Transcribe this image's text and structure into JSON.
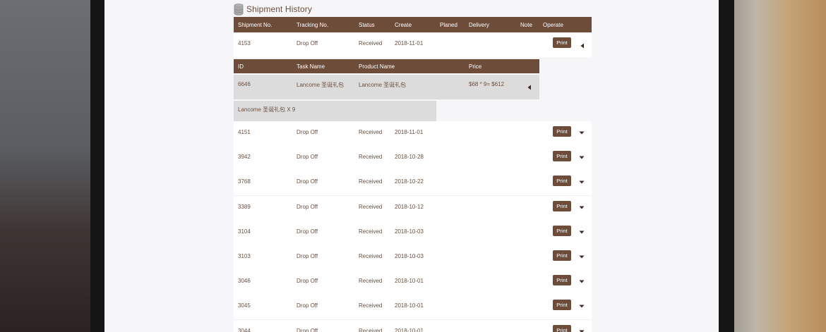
{
  "page_title": "Shipment History",
  "columns": [
    "Shipment No.",
    "Tracking No.",
    "Status",
    "Create",
    "Planed",
    "Delivery",
    "Note",
    "Operate"
  ],
  "expanded_shipment": {
    "no": "4153",
    "tracking": "Drop Off",
    "status": "Received",
    "create": "2018-11-01",
    "print_label": "Print",
    "detail_columns": [
      "ID",
      "Task Name",
      "Product Name",
      "Price"
    ],
    "detail_row": {
      "id": "6646",
      "task_name": "Lancome 圣诞礼包",
      "product_name": "Lancome 圣诞礼包",
      "price": "$68 * 9= $612"
    },
    "summary": "Lancome 圣诞礼包 X 9"
  },
  "shipments": [
    {
      "no": "4151",
      "tracking": "Drop Off",
      "status": "Received",
      "create": "2018-11-01",
      "print_label": "Print"
    },
    {
      "no": "3942",
      "tracking": "Drop Off",
      "status": "Received",
      "create": "2018-10-28",
      "print_label": "Print"
    },
    {
      "no": "3768",
      "tracking": "Drop Off",
      "status": "Received",
      "create": "2018-10-22",
      "print_label": "Print"
    },
    {
      "no": "3389",
      "tracking": "Drop Off",
      "status": "Received",
      "create": "2018-10-12",
      "print_label": "Print"
    },
    {
      "no": "3104",
      "tracking": "Drop Off",
      "status": "Received",
      "create": "2018-10-03",
      "print_label": "Print"
    },
    {
      "no": "3103",
      "tracking": "Drop Off",
      "status": "Received",
      "create": "2018-10-03",
      "print_label": "Print"
    },
    {
      "no": "3046",
      "tracking": "Drop Off",
      "status": "Received",
      "create": "2018-10-01",
      "print_label": "Print"
    },
    {
      "no": "3045",
      "tracking": "Drop Off",
      "status": "Received",
      "create": "2018-10-01",
      "print_label": "Print"
    },
    {
      "no": "3044",
      "tracking": "Drop Off",
      "status": "Received",
      "create": "2018-10-01",
      "print_label": "Print"
    }
  ],
  "colors": {
    "header_bg": "#6e4c3a",
    "text": "#6b4f3f",
    "detail_bg": "#dcdcdc"
  }
}
